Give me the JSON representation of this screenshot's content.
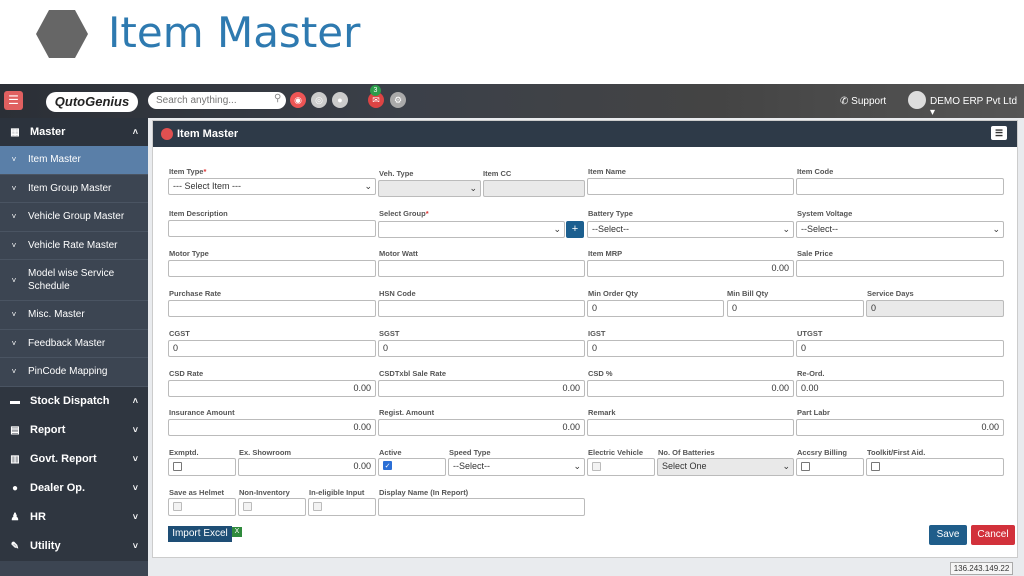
{
  "slide": {
    "title": "Item Master"
  },
  "topbar": {
    "logo": "QutoGenius",
    "search_placeholder": "Search anything...",
    "notification_count": "3",
    "support": "Support",
    "company": "DEMO ERP Pvt Ltd"
  },
  "sidebar": {
    "master": "Master",
    "items": [
      {
        "label": "Item Master",
        "active": true
      },
      {
        "label": "Item Group Master"
      },
      {
        "label": "Vehicle Group Master"
      },
      {
        "label": "Vehicle Rate Master"
      },
      {
        "label": "Model wise Service Schedule"
      },
      {
        "label": "Misc. Master"
      },
      {
        "label": "Feedback Master"
      },
      {
        "label": "PinCode Mapping"
      }
    ],
    "groups": [
      {
        "label": "Stock Dispatch"
      },
      {
        "label": "Report"
      },
      {
        "label": "Govt. Report"
      },
      {
        "label": "Dealer Op."
      },
      {
        "label": "HR"
      },
      {
        "label": "Utility"
      }
    ]
  },
  "panel": {
    "title": "Item Master"
  },
  "form": {
    "item_type": {
      "label": "Item Type",
      "value": "--- Select Item ---"
    },
    "veh_type": {
      "label": "Veh. Type",
      "value": ""
    },
    "item_cc": {
      "label": "Item CC",
      "value": ""
    },
    "item_name": {
      "label": "Item Name",
      "value": ""
    },
    "item_code": {
      "label": "Item Code",
      "value": ""
    },
    "item_description": {
      "label": "Item Description",
      "value": ""
    },
    "select_group": {
      "label": "Select Group",
      "value": ""
    },
    "battery_type": {
      "label": "Battery Type",
      "value": "--Select--"
    },
    "system_voltage": {
      "label": "System Voltage",
      "value": "--Select--"
    },
    "motor_type": {
      "label": "Motor Type",
      "value": ""
    },
    "motor_watt": {
      "label": "Motor Watt",
      "value": ""
    },
    "item_mrp": {
      "label": "Item MRP",
      "value": "0.00"
    },
    "sale_price": {
      "label": "Sale Price",
      "value": ""
    },
    "purchase_rate": {
      "label": "Purchase Rate",
      "value": ""
    },
    "hsn_code": {
      "label": "HSN Code",
      "value": ""
    },
    "min_order_qty": {
      "label": "Min Order Qty",
      "value": "0"
    },
    "min_bill_qty": {
      "label": "Min Bill Qty",
      "value": "0"
    },
    "service_days": {
      "label": "Service Days",
      "value": "0"
    },
    "cgst": {
      "label": "CGST",
      "value": "0"
    },
    "sgst": {
      "label": "SGST",
      "value": "0"
    },
    "igst": {
      "label": "IGST",
      "value": "0"
    },
    "utgst": {
      "label": "UTGST",
      "value": "0"
    },
    "csd_rate": {
      "label": "CSD Rate",
      "value": "0.00"
    },
    "csd_txbl": {
      "label": "CSDTxbl Sale Rate",
      "value": "0.00"
    },
    "csd_pct": {
      "label": "CSD %",
      "value": "0.00"
    },
    "re_ord": {
      "label": "Re-Ord.",
      "value": "0.00"
    },
    "insurance": {
      "label": "Insurance Amount",
      "value": "0.00"
    },
    "regist": {
      "label": "Regist. Amount",
      "value": "0.00"
    },
    "remark": {
      "label": "Remark",
      "value": ""
    },
    "part_labr": {
      "label": "Part Labr",
      "value": "0.00"
    },
    "exmptd": {
      "label": "Exmptd."
    },
    "ex_showroom": {
      "label": "Ex. Showroom",
      "value": "0.00"
    },
    "active": {
      "label": "Active"
    },
    "speed_type": {
      "label": "Speed Type",
      "value": "--Select--"
    },
    "electric_vehicle": {
      "label": "Electric Vehicle"
    },
    "no_batteries": {
      "label": "No. Of Batteries",
      "value": "Select One"
    },
    "accsry_billing": {
      "label": "Accsry Billing"
    },
    "toolkit": {
      "label": "Toolkit/First Aid."
    },
    "save_helmet": {
      "label": "Save as Helmet"
    },
    "non_inventory": {
      "label": "Non-Inventory"
    },
    "ineligible": {
      "label": "In-eligible Input"
    },
    "display_name": {
      "label": "Display Name (In Report)",
      "value": ""
    }
  },
  "buttons": {
    "import": "Import Excel",
    "save": "Save",
    "cancel": "Cancel"
  },
  "footer": {
    "ip": "136.243.149.22"
  }
}
